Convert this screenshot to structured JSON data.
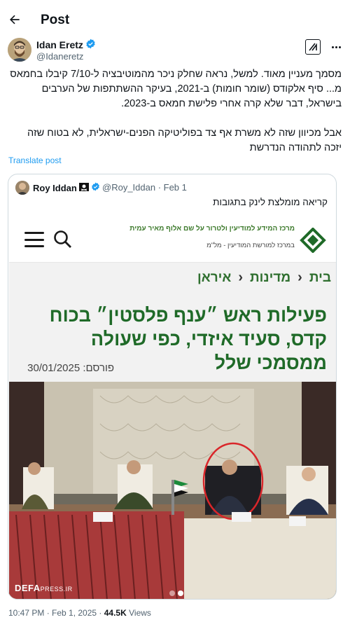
{
  "header": {
    "title": "Post"
  },
  "author": {
    "name": "Idan Eretz",
    "handle": "@Idaneretz"
  },
  "tweet": {
    "paragraph1": "מסמך מעניין מאוד. למשל, נראה שחלק ניכר מהמוטיבציה ל-7/10 קיבלו בחמאס מ... סיף אלקודס (שומר חומות) ב-2021, בעיקר ההשתתפות של הערבים בישראל, דבר שלא קרה אחרי פלישת חמאס ב-2023.",
    "paragraph2": "אבל מכיוון שזה לא משרת אף צד בפוליטיקה הפנים-ישראלית, לא בטוח שזה יזכה לתהודה הנדרשת"
  },
  "translate_label": "Translate post",
  "quote": {
    "name": "Roy Iddan",
    "meta": "@Roy_Iddan · Feb 1",
    "text": "קריאה מומלצת לינק בתגובות",
    "site": {
      "name": "מרכז המידע למודיעין ולטרור על שם אלוף מאיר עמית",
      "sub": "במרכז למורשת המודיעין - מל\"מ"
    },
    "breadcrumb": [
      "בית",
      "מדינות",
      "איראן"
    ],
    "article_title": "פעילות ראש ״ענף פלסטין״ בכוח קדס, סעיד איזדי, כפי שעולה ממסמכי שלל",
    "published": "פורסם: 30/01/2025",
    "watermark_main": "DEFA",
    "watermark_sub": "PRESS.IR"
  },
  "footer": {
    "time": "10:47 PM · Feb 1, 2025 · ",
    "views": "44.5K",
    "views_label": " Views"
  },
  "colors": {
    "link": "#1d9bf0",
    "verified": "#1d9bf0",
    "site_green": "#1f6a28",
    "circle": "#d9262a"
  }
}
